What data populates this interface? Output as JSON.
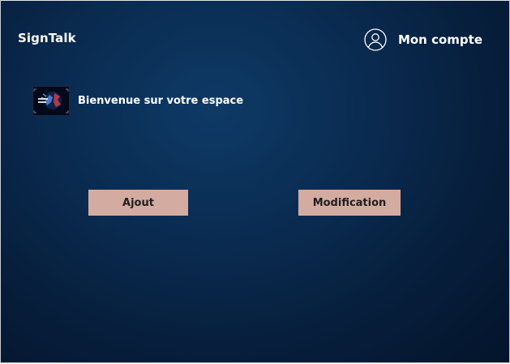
{
  "header": {
    "brand": "SignTalk",
    "account_label": "Mon compte",
    "account_icon": "user-circle-icon"
  },
  "welcome": {
    "text": "Bienvenue sur votre espace",
    "logo_icon": "signtalk-logo-icon"
  },
  "actions": {
    "add_label": "Ajout",
    "edit_label": "Modification"
  },
  "colors": {
    "background": "#0a2c52",
    "button": "#d4aba0",
    "button_text": "#1e1e1e",
    "text": "#ffffff"
  }
}
